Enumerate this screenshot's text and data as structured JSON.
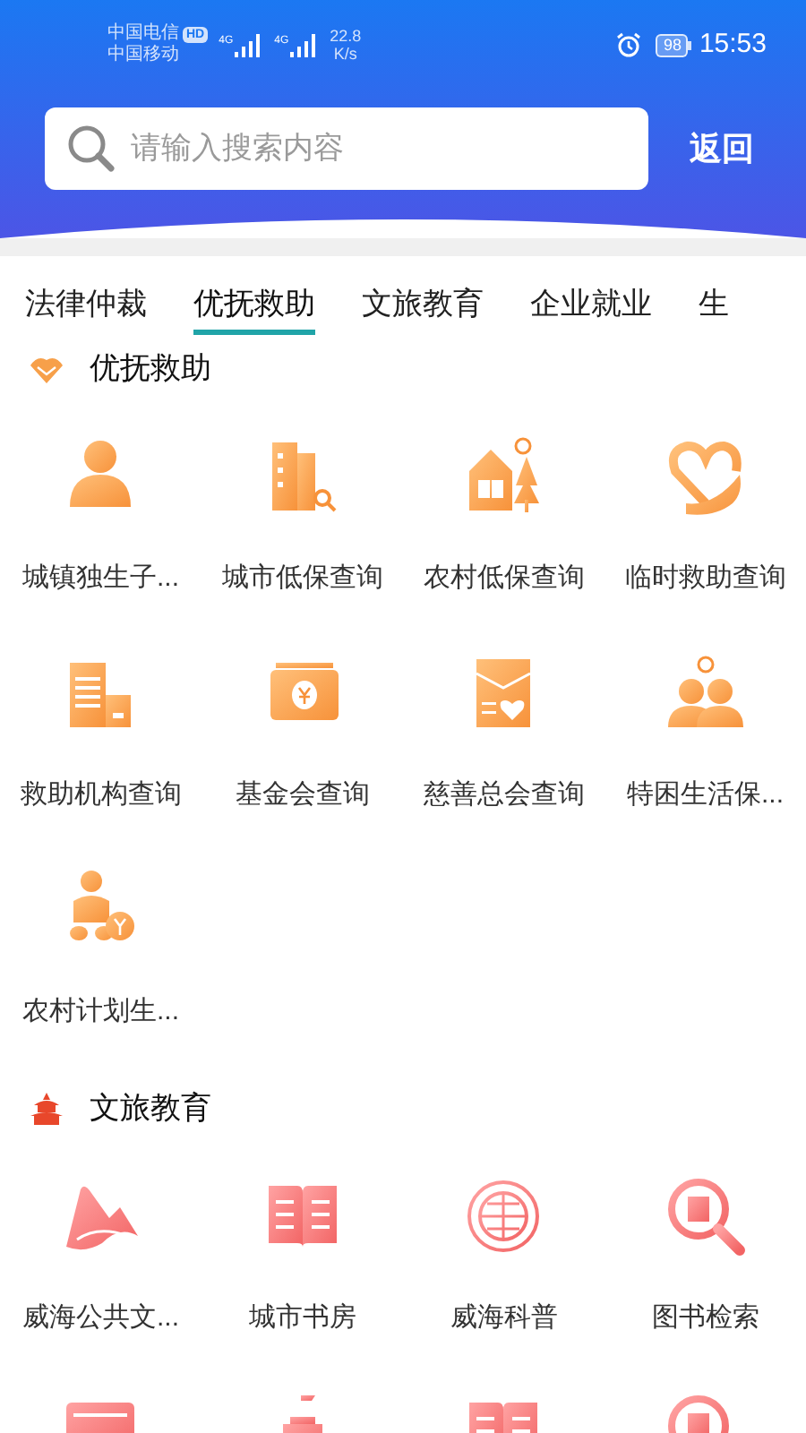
{
  "status_bar": {
    "carrier_1": "中国电信",
    "hd_badge": "HD",
    "carrier_2": "中国移动",
    "network_1": "4G",
    "network_2": "4G",
    "speed": "22.8",
    "speed_unit": "K/s",
    "battery": "98",
    "time": "15:53"
  },
  "search": {
    "placeholder": "请输入搜索内容"
  },
  "back_button": "返回",
  "tabs": [
    {
      "label": "法律仲裁",
      "selected": false
    },
    {
      "label": "优抚救助",
      "selected": true
    },
    {
      "label": "文旅教育",
      "selected": false
    },
    {
      "label": "企业就业",
      "selected": false
    },
    {
      "label": "生",
      "selected": false
    }
  ],
  "sections": [
    {
      "title": "优抚救助",
      "kind": "aid",
      "items": [
        {
          "label": "城镇独生子...",
          "kind": "person"
        },
        {
          "label": "城市低保查询",
          "kind": "building"
        },
        {
          "label": "农村低保查询",
          "kind": "house"
        },
        {
          "label": "临时救助查询",
          "kind": "heart"
        },
        {
          "label": "救助机构查询",
          "kind": "hospital"
        },
        {
          "label": "基金会查询",
          "kind": "money"
        },
        {
          "label": "慈善总会查询",
          "kind": "envelope"
        },
        {
          "label": "特困生活保...",
          "kind": "people"
        },
        {
          "label": "农村计划生...",
          "kind": "baby"
        }
      ]
    },
    {
      "title": "文旅教育",
      "kind": "culture",
      "items": [
        {
          "label": "威海公共文...",
          "kind": "scroll"
        },
        {
          "label": "城市书房",
          "kind": "book"
        },
        {
          "label": "威海科普",
          "kind": "globe"
        },
        {
          "label": "图书检索",
          "kind": "magnifier"
        },
        {
          "kind": "card"
        },
        {
          "kind": "tower"
        },
        {
          "kind": "book"
        },
        {
          "kind": "magnifier"
        }
      ]
    }
  ]
}
